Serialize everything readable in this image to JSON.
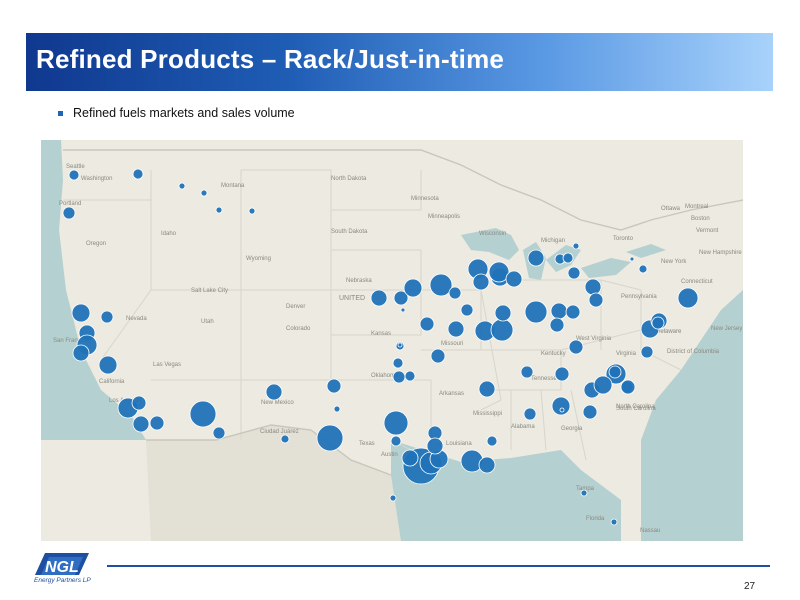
{
  "slide": {
    "title": "Refined Products – Rack/Just-in-time",
    "bullet": "Refined fuels markets and sales volume",
    "page_number": "27"
  },
  "logo": {
    "wordmark": "NGL",
    "tagline": "Energy Partners LP"
  },
  "colors": {
    "title_bar_start": "#10388f",
    "title_bar_end": "#a8d2fb",
    "marker": "#2173b8",
    "map_land": "#eceae1",
    "map_water": "#b5d0d0",
    "footer_line": "#1e4fa0"
  },
  "map": {
    "place_labels": [
      "Seattle",
      "Washington",
      "Portland",
      "Oregon",
      "Montana",
      "Idaho",
      "Wyoming",
      "North Dakota",
      "South Dakota",
      "Nebraska",
      "UNITED",
      "Minnesota",
      "Minneapolis",
      "Wisconsin",
      "Michigan",
      "Ottawa",
      "Montreal",
      "Toronto",
      "Vermont",
      "New Hampshire",
      "Boston",
      "New York",
      "Connecticut",
      "Pennsylvania",
      "Delaware",
      "New Jersey",
      "District of Columbia",
      "West Virginia",
      "Kentucky",
      "Tennessee",
      "North Carolina",
      "South Carolina",
      "Georgia",
      "Alabama",
      "Mississippi",
      "Arkansas",
      "Missouri",
      "Kansas",
      "Oklahoma",
      "Texas",
      "Austin",
      "Louisiana",
      "Florida",
      "Tampa",
      "Nassau",
      "Salt Lake City",
      "Denver",
      "Colorado",
      "Utah",
      "Nevada",
      "San Francisco",
      "California",
      "Las Vegas",
      "Los Angeles",
      "New Mexico",
      "Ciudad Juárez",
      "Virginia"
    ],
    "markers": [
      {
        "name": "seattle",
        "r": 5
      },
      {
        "name": "portland",
        "r": 6
      },
      {
        "name": "spokane",
        "r": 5
      },
      {
        "name": "montana-1",
        "r": 3
      },
      {
        "name": "montana-2",
        "r": 3
      },
      {
        "name": "montana-3",
        "r": 3
      },
      {
        "name": "montana-4",
        "r": 3
      },
      {
        "name": "reno",
        "r": 6
      },
      {
        "name": "ca-north-1",
        "r": 9
      },
      {
        "name": "ca-north-2",
        "r": 8
      },
      {
        "name": "ca-north-3",
        "r": 10
      },
      {
        "name": "ca-north-4",
        "r": 8
      },
      {
        "name": "ca-central",
        "r": 9
      },
      {
        "name": "la-1",
        "r": 10
      },
      {
        "name": "la-2",
        "r": 7
      },
      {
        "name": "san-diego-1",
        "r": 8
      },
      {
        "name": "san-diego-2",
        "r": 7
      },
      {
        "name": "phoenix",
        "r": 13
      },
      {
        "name": "tucson",
        "r": 6
      },
      {
        "name": "el-paso",
        "r": 4
      },
      {
        "name": "new-mexico",
        "r": 8
      },
      {
        "name": "west-texas",
        "r": 13
      },
      {
        "name": "texas-panhandle",
        "r": 7
      },
      {
        "name": "nebraska-1",
        "r": 8
      },
      {
        "name": "nebraska-2",
        "r": 7
      },
      {
        "name": "nebraska-3",
        "r": 9
      },
      {
        "name": "iowa-1",
        "r": 11
      },
      {
        "name": "iowa-2",
        "r": 6
      },
      {
        "name": "kansas-1",
        "r": 7
      },
      {
        "name": "kansas-2",
        "r": 4
      },
      {
        "name": "oklahoma-1",
        "r": 5
      },
      {
        "name": "oklahoma-2",
        "r": 6
      },
      {
        "name": "oklahoma-3",
        "r": 5
      },
      {
        "name": "missouri-1",
        "r": 7
      },
      {
        "name": "missouri-2",
        "r": 8
      },
      {
        "name": "missouri-3",
        "r": 10
      },
      {
        "name": "missouri-4",
        "r": 6
      },
      {
        "name": "illinois-1",
        "r": 10
      },
      {
        "name": "illinois-2",
        "r": 8
      },
      {
        "name": "illinois-3",
        "r": 9
      },
      {
        "name": "indiana-1",
        "r": 11
      },
      {
        "name": "indiana-2",
        "r": 8
      },
      {
        "name": "ohio-1",
        "r": 10
      },
      {
        "name": "ohio-2",
        "r": 8
      },
      {
        "name": "michigan-1",
        "r": 8
      },
      {
        "name": "michigan-2",
        "r": 5
      },
      {
        "name": "michigan-3",
        "r": 6
      },
      {
        "name": "michigan-4",
        "r": 5
      },
      {
        "name": "michigan-5",
        "r": 3
      },
      {
        "name": "kentucky-1",
        "r": 11
      },
      {
        "name": "kentucky-2",
        "r": 8
      },
      {
        "name": "kentucky-3",
        "r": 7
      },
      {
        "name": "kentucky-4",
        "r": 7
      },
      {
        "name": "ohio-3",
        "r": 7
      },
      {
        "name": "pittsburgh",
        "r": 8
      },
      {
        "name": "pennsylvania",
        "r": 7
      },
      {
        "name": "new-jersey",
        "r": 10
      },
      {
        "name": "dc-1",
        "r": 9
      },
      {
        "name": "dc-2",
        "r": 8
      },
      {
        "name": "dc-3",
        "r": 6
      },
      {
        "name": "virginia",
        "r": 6
      },
      {
        "name": "richmond",
        "r": 6
      },
      {
        "name": "dallas",
        "r": 12
      },
      {
        "name": "houston-1",
        "r": 18
      },
      {
        "name": "houston-2",
        "r": 11
      },
      {
        "name": "houston-3",
        "r": 9
      },
      {
        "name": "austin",
        "r": 5
      },
      {
        "name": "san-antonio",
        "r": 8
      },
      {
        "name": "corpus",
        "r": 3
      },
      {
        "name": "louisiana-1",
        "r": 11
      },
      {
        "name": "louisiana-2",
        "r": 8
      },
      {
        "name": "louisiana-3",
        "r": 7
      },
      {
        "name": "mississippi",
        "r": 8
      },
      {
        "name": "alabama-1",
        "r": 6
      },
      {
        "name": "alabama-2",
        "r": 5
      },
      {
        "name": "georgia-1",
        "r": 9
      },
      {
        "name": "georgia-2",
        "r": 7
      },
      {
        "name": "carolina-1",
        "r": 8
      },
      {
        "name": "carolina-2",
        "r": 10
      },
      {
        "name": "carolina-3",
        "r": 9
      },
      {
        "name": "carolina-4",
        "r": 7
      },
      {
        "name": "carolina-5",
        "r": 6
      },
      {
        "name": "tennessee-1",
        "r": 6
      },
      {
        "name": "tennessee-2",
        "r": 7
      },
      {
        "name": "arkansas",
        "r": 8
      },
      {
        "name": "tampa",
        "r": 3
      },
      {
        "name": "florida-south",
        "r": 3
      },
      {
        "name": "ontario-1",
        "r": 4
      },
      {
        "name": "ontario-2",
        "r": 2
      },
      {
        "name": "ontario-3",
        "r": 2
      },
      {
        "name": "nebraska-4",
        "r": 2
      },
      {
        "name": "oklahoma-4",
        "r": 2
      },
      {
        "name": "missouri-5",
        "r": 3
      },
      {
        "name": "alabama-3",
        "r": 3
      },
      {
        "name": "texas-small",
        "r": 2
      }
    ]
  }
}
